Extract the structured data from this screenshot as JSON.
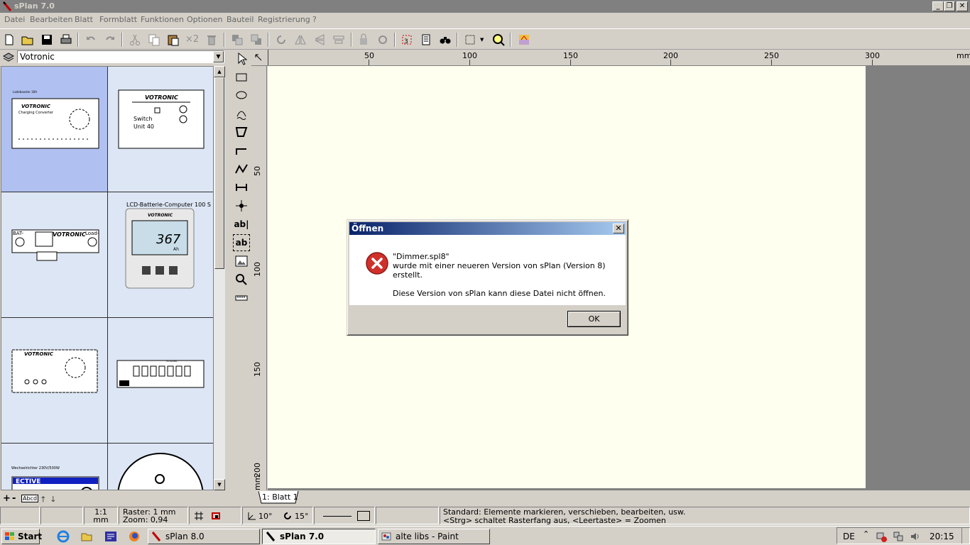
{
  "window": {
    "title": "sPlan 7.0"
  },
  "menu": [
    "Datei",
    "Bearbeiten",
    "Blatt",
    "Formblatt",
    "Funktionen",
    "Optionen",
    "Bauteil",
    "Registrierung",
    "?"
  ],
  "toolbar": {
    "x2_label": "×2"
  },
  "library": {
    "selected": "Votronic",
    "items": [
      {
        "caption": "Ladebooster 30A",
        "brand": "VOTRONIC",
        "text": "Charging Converter"
      },
      {
        "caption": "",
        "brand": "VOTRONIC",
        "text": "Switch Unit 40"
      },
      {
        "caption": "",
        "brand": "VOTRONIC",
        "text": "BAT- / Load-"
      },
      {
        "caption": "LCD-Batterie-Computer 100 S",
        "brand": "VOTRONIC",
        "text": "367 Ah"
      },
      {
        "caption": "",
        "brand": "VOTRONIC",
        "text": ""
      },
      {
        "caption": "",
        "brand": "VOTRONIC",
        "text": ""
      },
      {
        "caption": "Wechselrichter 230V/500W",
        "brand": "ECTIVE",
        "text": ""
      },
      {
        "caption": "",
        "brand": "",
        "text": ""
      }
    ],
    "bottom_tag": "Abcd"
  },
  "ruler": {
    "h": [
      "50",
      "100",
      "150",
      "200",
      "250",
      "300",
      "mm"
    ],
    "v": [
      "50",
      "100",
      "150",
      "200",
      "mm"
    ]
  },
  "sheet_tab": "1: Blatt 1",
  "status": {
    "scale": "1:1",
    "scale_unit": "mm",
    "raster": "Raster: 1 mm",
    "zoom": "Zoom:  0,94",
    "angle1": "10°",
    "angle2": "15°",
    "hint1": "Standard: Elemente markieren, verschieben, bearbeiten, usw.",
    "hint2": "<Strg> schaltet Rasterfang aus, <Leertaste> = Zoomen"
  },
  "taskbar": {
    "start": "Start",
    "tasks": [
      "sPlan 8.0",
      "sPlan 7.0",
      "alte libs - Paint"
    ],
    "lang": "DE",
    "time": "20:15"
  },
  "dialog": {
    "title": "Öffnen",
    "line1": "\"Dimmer.spl8\"",
    "line2": "wurde mit einer neueren Version von sPlan (Version 8) erstellt.",
    "line3": "Diese Version von sPlan kann diese Datei nicht öffnen.",
    "ok": "OK"
  }
}
